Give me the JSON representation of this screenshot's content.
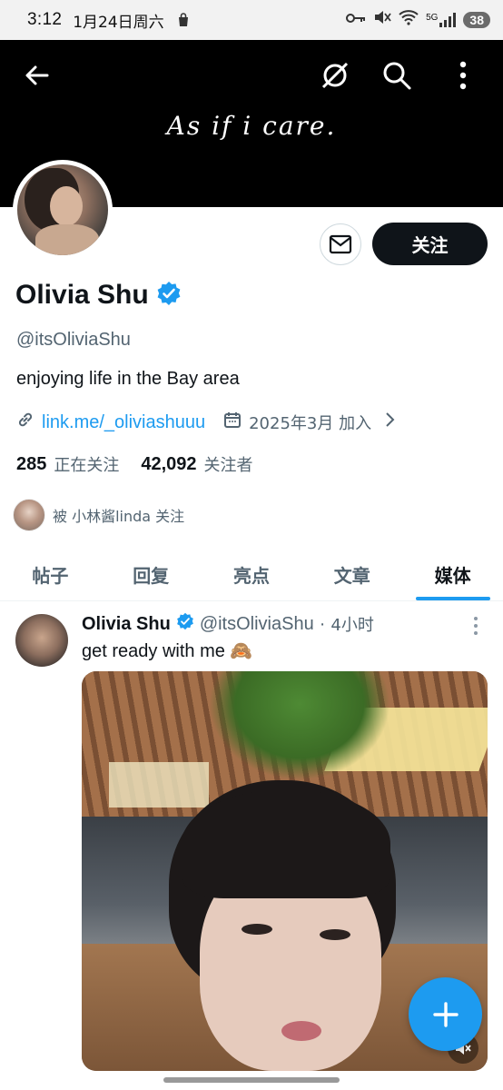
{
  "status_bar": {
    "time": "3:12",
    "date": "1月24日周六",
    "network": "5G",
    "battery": "38"
  },
  "banner": {
    "tagline": "As if i care."
  },
  "profile": {
    "name": "Olivia Shu",
    "handle": "@itsOliviaShu",
    "bio": "enjoying life in the Bay area",
    "link": "link.me/_oliviashuuu",
    "joined": "2025年3月 加入",
    "following_count": "285",
    "following_label": "正在关注",
    "followers_count": "42,092",
    "followers_label": "关注者",
    "followed_by": "被 小林酱linda 关注",
    "follow_button": "关注"
  },
  "tabs": [
    {
      "label": "帖子"
    },
    {
      "label": "回复"
    },
    {
      "label": "亮点"
    },
    {
      "label": "文章"
    },
    {
      "label": "媒体"
    }
  ],
  "active_tab": "媒体",
  "post": {
    "name": "Olivia Shu",
    "handle": "@itsOliviaShu",
    "separator": "·",
    "time": "4小时",
    "text": "get ready with me 🙈"
  },
  "colors": {
    "accent": "#1d9bf0",
    "text": "#0f1419",
    "secondary": "#536471"
  }
}
